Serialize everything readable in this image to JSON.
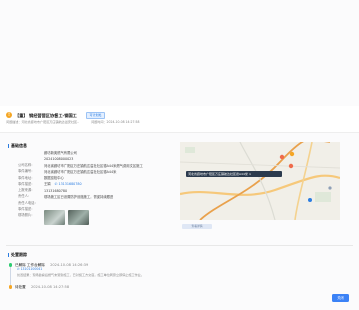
{
  "header": {
    "title": "【重】 钢经营营区协督工-钢国工",
    "badge": "可计划处",
    "meta_left": "问题描述：河北省廊坊市广阳区万庄镇航达溢安社区..",
    "meta_right": "问题时间：2024-10-08 14:27:58"
  },
  "info_section": {
    "title": "基础信息",
    "rows": [
      {
        "label": "公司名称：",
        "value": "廊坊新奥燃气有限公司"
      },
      {
        "label": "事件编号：",
        "value": "20241008000023"
      },
      {
        "label": "事件地址：",
        "value": "河北省廊坊市广阳区万庄镇航达溢社社区德A44米燃气费用文区施工"
      },
      {
        "label": "事件描述：",
        "value": "河北省廊坊市广阳区万庄镇航达溢社社区德A44米"
      },
      {
        "label": "上报来源：",
        "value": "数据巡检中心"
      },
      {
        "label": "责任人：",
        "value": "王娟"
      },
      {
        "label": "责任人电话：",
        "value": "13131680780"
      },
      {
        "label": "事件描述：",
        "value": "现场施工区已设置防护设施施工，督促持续跟进"
      },
      {
        "label": "现场照片：",
        "value": ""
      }
    ]
  },
  "map": {
    "tooltip": "河北省廊坊市广阳区万庄镇航达社区德A44米 ×",
    "button_label": "查看详情"
  },
  "timeline_section": {
    "title": "处置跟踪",
    "events": [
      {
        "status": "已解除 工作台解除",
        "time": "2024-10-08 14:26:39",
        "phone": "13101100041",
        "desc": "处置结果：现场勘察后燃气未受到施工，已对施工方交底，施工单位同意立即停止施工作业。"
      },
      {
        "status": "待处置",
        "time": "2024-10-08 14:27:58"
      }
    ]
  },
  "actions": {
    "primary_label": "关闭"
  },
  "colors": {
    "accent": "#2b7de1",
    "warning": "#f5a623",
    "success": "#2ecc71",
    "pending": "#f5a623"
  }
}
